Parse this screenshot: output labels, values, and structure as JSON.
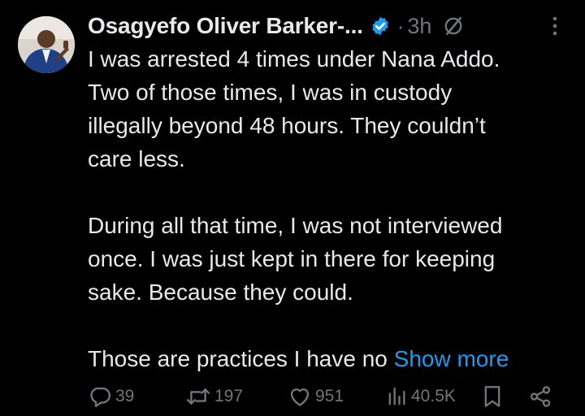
{
  "author": {
    "display_name": "Osagyefo Oliver Barker-...",
    "verified": true,
    "avatar_icon": "profile-photo"
  },
  "meta": {
    "separator": "·",
    "time": "3h",
    "grok_icon": "grok-icon",
    "more_icon": "more-vertical-icon"
  },
  "body": {
    "paragraphs": [
      {
        "lines": [
          "I was arrested 4 times under Nana Addo.",
          "Two of those times, I was in custody",
          "illegally beyond 48 hours. They couldn’t",
          "care less."
        ]
      },
      {
        "lines": [
          "During all that time, I was not interviewed",
          "once. I was just kept in there for keeping",
          "sake. Because they could."
        ]
      },
      {
        "lines": [
          "Those are practices I have no "
        ]
      }
    ],
    "show_more_label": "Show more"
  },
  "actions": {
    "replies": {
      "icon": "reply-icon",
      "count": "39"
    },
    "reposts": {
      "icon": "repost-icon",
      "count": "197"
    },
    "likes": {
      "icon": "heart-icon",
      "count": "951"
    },
    "views": {
      "icon": "views-icon",
      "count": "40.5K"
    },
    "bookmark": {
      "icon": "bookmark-icon"
    },
    "share": {
      "icon": "share-icon"
    }
  },
  "colors": {
    "background": "#000000",
    "text": "#e7e9ea",
    "secondary": "#71767b",
    "accent": "#1d9bf0"
  }
}
